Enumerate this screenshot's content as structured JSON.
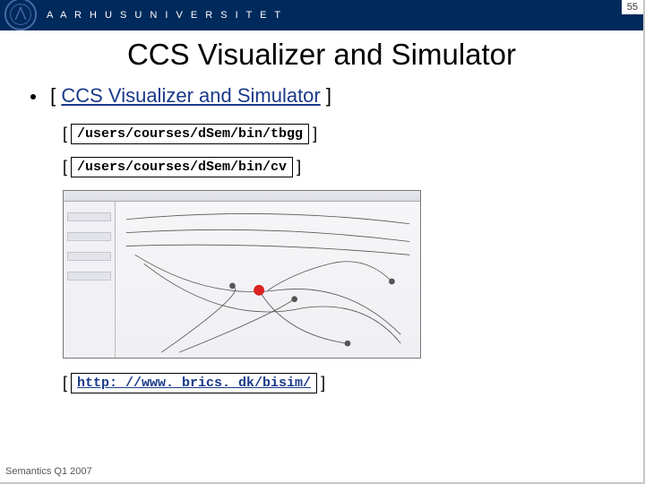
{
  "header": {
    "university": "A A R H U S   U N I V E R S I T E T",
    "page_number": "55"
  },
  "title": "CCS Visualizer and Simulator",
  "bullet": {
    "prefix": "[ ",
    "link_text": "CCS Visualizer and Simulator",
    "suffix": " ]"
  },
  "paths": [
    {
      "open": "[",
      "value": "/users/courses/dSem/bin/tbgg",
      "close": "]"
    },
    {
      "open": "[",
      "value": "/users/courses/dSem/bin/cv",
      "close": "]"
    }
  ],
  "url": {
    "open": "[",
    "href": "http: //www. brics. dk/bisim/",
    "close": "]"
  },
  "footer": "Semantics Q1 2007"
}
